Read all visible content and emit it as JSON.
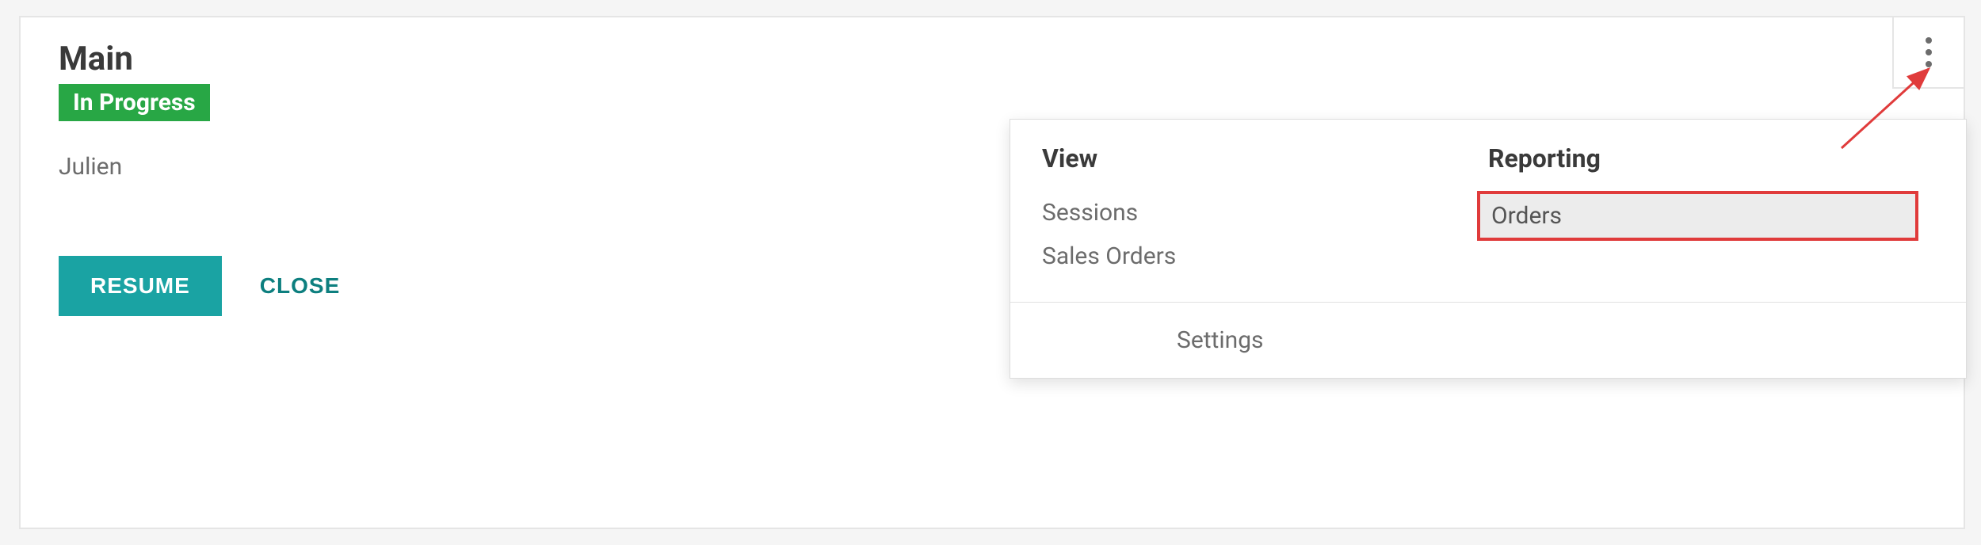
{
  "card": {
    "title": "Main",
    "status": "In Progress",
    "user": "Julien",
    "buttons": {
      "resume": "RESUME",
      "close": "CLOSE"
    }
  },
  "dropdown": {
    "columns": [
      {
        "heading": "View",
        "items": [
          "Sessions",
          "Sales Orders"
        ]
      },
      {
        "heading": "Reporting",
        "items": [
          "Orders"
        ]
      }
    ],
    "settings": "Settings"
  }
}
